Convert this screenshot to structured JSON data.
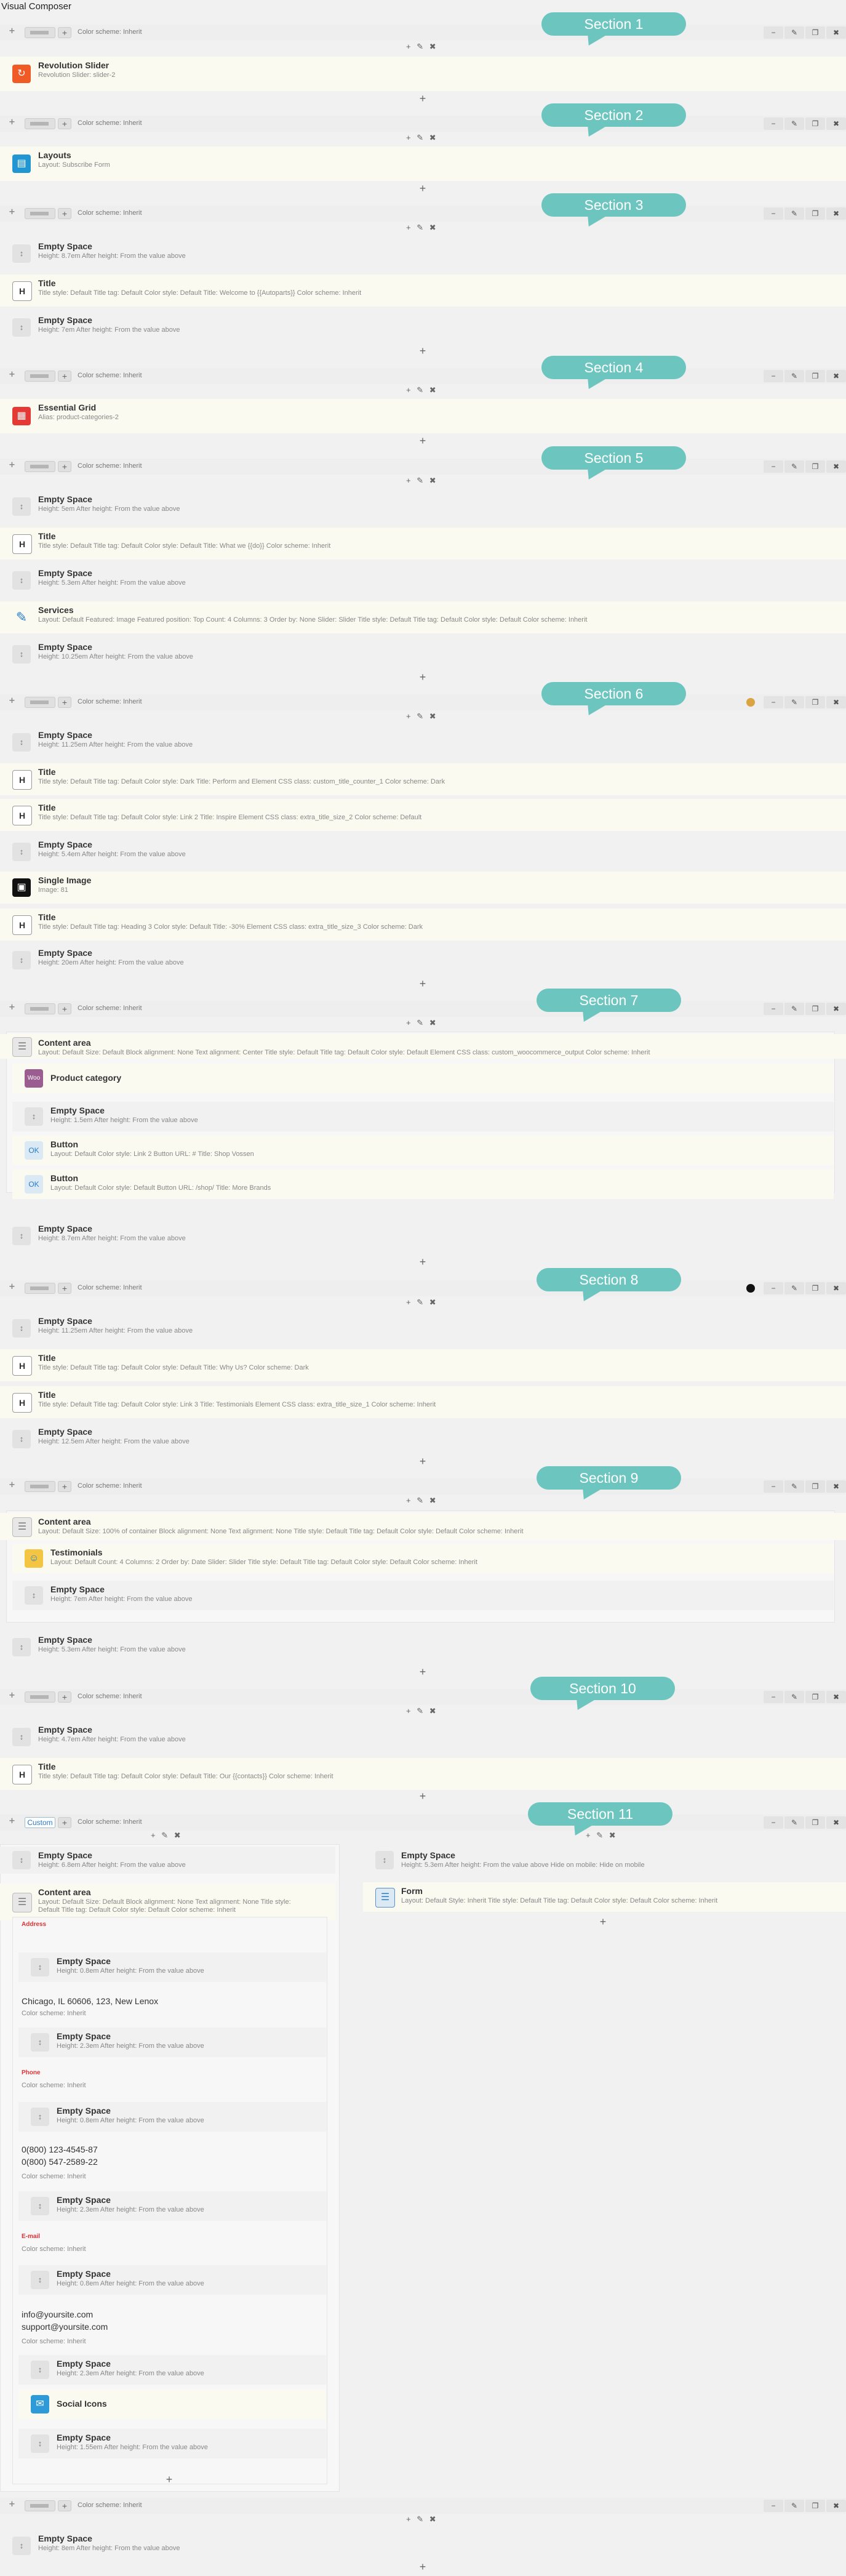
{
  "page_title": "Visual Composer",
  "row_color_scheme": "Color scheme: Inherit",
  "row_tools": [
    "−",
    "✎",
    "❐",
    "✖"
  ],
  "col_tools": "+ ✎ ✖",
  "plus": "+",
  "sections": [
    "Section 1",
    "Section 2",
    "Section 3",
    "Section 4",
    "Section 5",
    "Section 6",
    "Section 7",
    "Section 8",
    "Section 9",
    "Section 10",
    "Section 11"
  ],
  "custom_label": "Custom",
  "elements": {
    "rev": {
      "title": "Revolution Slider",
      "desc": "Revolution Slider: slider-2"
    },
    "layouts": {
      "title": "Layouts",
      "desc": "Layout: Subscribe Form"
    },
    "s3_space1": {
      "title": "Empty Space",
      "desc": "Height: 8.7em After height: From the value above"
    },
    "s3_title": {
      "title": "Title",
      "desc": "Title style: Default Title tag: Default Color style: Default Title: Welcome to {{Autoparts}} Color scheme: Inherit"
    },
    "s3_space2": {
      "title": "Empty Space",
      "desc": "Height: 7em After height: From the value above"
    },
    "grid": {
      "title": "Essential Grid",
      "desc": "Alias: product-categories-2"
    },
    "s5_space1": {
      "title": "Empty Space",
      "desc": "Height: 5em After height: From the value above"
    },
    "s5_title": {
      "title": "Title",
      "desc": "Title style: Default Title tag: Default Color style: Default Title: What we {{do}} Color scheme: Inherit"
    },
    "s5_space2": {
      "title": "Empty Space",
      "desc": "Height: 5.3em After height: From the value above"
    },
    "services": {
      "title": "Services",
      "desc": "Layout: Default Featured: Image Featured position: Top Count: 4 Columns: 3 Order by: None Slider: Slider Title style: Default Title tag: Default Color style: Default Color scheme: Inherit"
    },
    "s5_space3": {
      "title": "Empty Space",
      "desc": "Height: 10.25em After height: From the value above"
    },
    "s6_space1": {
      "title": "Empty Space",
      "desc": "Height: 11.25em After height: From the value above"
    },
    "s6_title1": {
      "title": "Title",
      "desc": "Title style: Default Title tag: Default Color style: Dark Title: Perform and Element CSS class: custom_title_counter_1 Color scheme: Dark"
    },
    "s6_title2": {
      "title": "Title",
      "desc": "Title style: Default Title tag: Default Color style: Link 2 Title: Inspire Element CSS class: extra_title_size_2 Color scheme: Default"
    },
    "s6_space2": {
      "title": "Empty Space",
      "desc": "Height: 5.4em After height: From the value above"
    },
    "s6_image": {
      "title": "Single Image",
      "desc": "Image: 81"
    },
    "s6_title3": {
      "title": "Title",
      "desc": "Title style: Default Title tag: Heading 3 Color style: Default Title: -30% Element CSS class: extra_title_size_3 Color scheme: Dark"
    },
    "s6_space3": {
      "title": "Empty Space",
      "desc": "Height: 20em After height: From the value above"
    },
    "s7_content": {
      "title": "Content area",
      "desc": "Layout: Default Size: Default Block alignment: None Text alignment: Center Title style: Default Title tag: Default Color style: Default Element CSS class: custom_woocommerce_output Color scheme: Inherit"
    },
    "s7_woo": {
      "title": "Product category",
      "desc": ""
    },
    "s7_space1": {
      "title": "Empty Space",
      "desc": "Height: 1.5em After height: From the value above"
    },
    "s7_btn1": {
      "title": "Button",
      "desc": "Layout: Default Color style: Link 2 Button URL: # Title: Shop Vossen"
    },
    "s7_btn2": {
      "title": "Button",
      "desc": "Layout: Default Color style: Default Button URL: /shop/ Title: More Brands"
    },
    "s7_space2": {
      "title": "Empty Space",
      "desc": "Height: 8.7em After height: From the value above"
    },
    "s8_space1": {
      "title": "Empty Space",
      "desc": "Height: 11.25em After height: From the value above"
    },
    "s8_title1": {
      "title": "Title",
      "desc": "Title style: Default Title tag: Default Color style: Default Title: Why Us? Color scheme: Dark"
    },
    "s8_title2": {
      "title": "Title",
      "desc": "Title style: Default Title tag: Default Color style: Link 3 Title: Testimonials Element CSS class: extra_title_size_1 Color scheme: Inherit"
    },
    "s8_space2": {
      "title": "Empty Space",
      "desc": "Height: 12.5em After height: From the value above"
    },
    "s9_content": {
      "title": "Content area",
      "desc": "Layout: Default Size: 100% of container Block alignment: None Text alignment: None Title style: Default Title tag: Default Color style: Default Color scheme: Inherit"
    },
    "s9_test": {
      "title": "Testimonials",
      "desc": "Layout: Default Count: 4 Columns: 2 Order by: Date Slider: Slider Title style: Default Title tag: Default Color style: Default Color scheme: Inherit"
    },
    "s9_space1": {
      "title": "Empty Space",
      "desc": "Height: 7em After height: From the value above"
    },
    "s9_space2": {
      "title": "Empty Space",
      "desc": "Height: 5.3em After height: From the value above"
    },
    "s10_space": {
      "title": "Empty Space",
      "desc": "Height: 4.7em After height: From the value above"
    },
    "s10_title": {
      "title": "Title",
      "desc": "Title style: Default Title tag: Default Color style: Default Title: Our {{contacts}} Color scheme: Inherit"
    },
    "s11_space0": {
      "title": "Empty Space",
      "desc": "Height: 6.8em After height: From the value above"
    },
    "s11_content": {
      "title": "Content area",
      "desc": "Layout: Default Size: Default Block alignment: None Text alignment: None Title style:"
    },
    "s11_content2": {
      "desc": "Default Title tag: Default Color style: Default Color scheme: Inherit"
    },
    "s11_scheme1": "Color scheme: Inherit",
    "s11_address_label": "Address",
    "s11_space1": {
      "title": "Empty Space",
      "desc": "Height: 0.8em After height: From the value above"
    },
    "s11_address": "Chicago, IL 60606, 123, New Lenox",
    "s11_scheme2": "Color scheme: Inherit",
    "s11_space2": {
      "title": "Empty Space",
      "desc": "Height: 2.3em After height: From the value above"
    },
    "s11_phone_label": "Phone",
    "s11_scheme3": "Color scheme: Inherit",
    "s11_space3": {
      "title": "Empty Space",
      "desc": "Height: 0.8em After height: From the value above"
    },
    "s11_phone1": "0(800) 123-4545-87",
    "s11_phone2": "0(800) 547-2589-22",
    "s11_scheme4": "Color scheme: Inherit",
    "s11_space4": {
      "title": "Empty Space",
      "desc": "Height: 2.3em After height: From the value above"
    },
    "s11_email_label": "E-mail",
    "s11_scheme5": "Color scheme: Inherit",
    "s11_space5": {
      "title": "Empty Space",
      "desc": "Height: 0.8em After height: From the value above"
    },
    "s11_email1": "info@yoursite.com",
    "s11_email2": "support@yoursite.com",
    "s11_scheme6": "Color scheme: Inherit",
    "s11_space6": {
      "title": "Empty Space",
      "desc": "Height: 2.3em After height: From the value above"
    },
    "s11_social": {
      "title": "Social Icons",
      "desc": ""
    },
    "s11_space7": {
      "title": "Empty Space",
      "desc": "Height: 1.55em After height: From the value above"
    },
    "s11_r_space": {
      "title": "Empty Space",
      "desc": "Height: 5.3em After height: From the value above Hide on mobile: Hide on mobile"
    },
    "s11_form": {
      "title": "Form",
      "desc": "Layout: Default Style: Inherit Title style: Default Title tag: Default Color style: Default Color scheme: Inherit"
    },
    "last_space": {
      "title": "Empty Space",
      "desc": "Height: 8em After height: From the value above"
    }
  },
  "colors": {
    "section_badge": "#6cc6bf",
    "element_bg": "#fafaf0",
    "row_bar": "#eeeeee"
  },
  "icons": [
    "plus-icon",
    "pencil-icon",
    "trash-icon",
    "copy-icon",
    "minus-icon",
    "spacer-icon",
    "title-icon",
    "slider-icon",
    "layout-icon",
    "grid-icon",
    "services-icon",
    "image-icon",
    "content-icon",
    "woo-icon",
    "button-icon",
    "testimonials-icon",
    "form-icon",
    "social-icon"
  ]
}
